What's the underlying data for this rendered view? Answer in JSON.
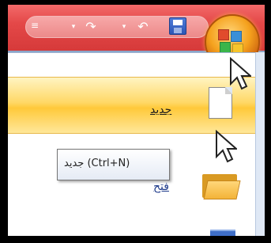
{
  "quick_access_toolbar": {
    "customize_glyph": "≡",
    "redo_icon": "redo-icon",
    "undo_icon": "undo-icon",
    "save_icon": "save-icon",
    "dropdown_glyph": "▾",
    "redo_glyph": "↷",
    "undo_glyph": "↶"
  },
  "office_button": {
    "icon": "office-logo-icon"
  },
  "menu": {
    "items": [
      {
        "label": "جديد",
        "icon": "new-document-icon",
        "highlighted": true
      },
      {
        "label": "فتح",
        "icon": "open-folder-icon",
        "highlighted": false
      }
    ]
  },
  "tooltip": {
    "text": "جديد (Ctrl+N)"
  },
  "colors": {
    "title_bar": "#e44848",
    "highlight": "#ffd866",
    "office_button": "#f5a21e"
  }
}
